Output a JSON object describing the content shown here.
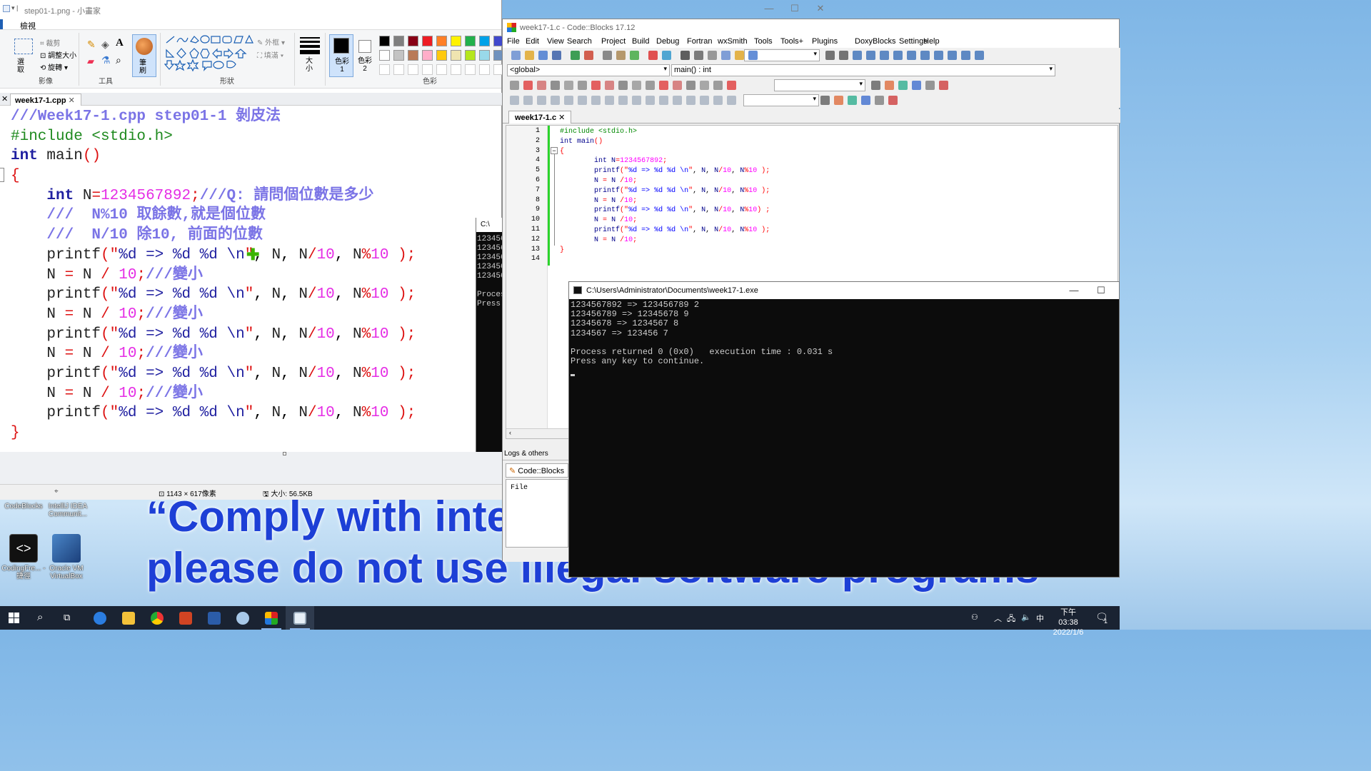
{
  "desktop": {
    "banner_line1": "“Comply with inte",
    "banner_line2": "please do not use illegal software programs",
    "icons": [
      {
        "label": "CodeBlocks"
      },
      {
        "label": "IntelliJ IDEA Communit..."
      },
      {
        "label": "CodingFre... - 捷徑"
      },
      {
        "label": "Oracle VM VirtualBox"
      }
    ]
  },
  "paint": {
    "title": "step01-1.png - 小畫家",
    "tab_view": "檢視",
    "groups": {
      "image": "影像",
      "tools": "工具",
      "shapes": "形狀",
      "colors": "色彩"
    },
    "image_items": {
      "crop": "裁剪",
      "resize": "調整大小",
      "rotate": "旋轉",
      "select": "選取"
    },
    "shape_items": {
      "outline": "外框",
      "fill": "填滿"
    },
    "brush_label": "筆刷",
    "size_label": "大小",
    "color1_label": "色彩 1",
    "color2_label": "色彩 2",
    "doc_tab": "week17-1.cpp",
    "status": {
      "dimensions": "1143 × 617像素",
      "size": "大小: 56.5KB"
    },
    "palette": [
      "#000000",
      "#7f7f7f",
      "#880015",
      "#ed1c24",
      "#ff7f27",
      "#fff200",
      "#22b14c",
      "#00a2e8",
      "#3f48cc",
      "#a349a4",
      "#ffffff",
      "#c3c3c3",
      "#b97a57",
      "#ffaec9",
      "#ffc90e",
      "#efe4b0",
      "#b5e61d",
      "#99d9ea",
      "#7092be",
      "#c8bfe7"
    ],
    "code_lines": [
      "///Week17-1.cpp step01-1 剝皮法",
      "#include <stdio.h>",
      "int main()",
      "{",
      "    int N=1234567892;///Q: 請問個位數是多少",
      "    ///  N%10 取餘數,就是個位數",
      "    ///  N/10 除10, 前面的位數",
      "    printf(\"%d => %d %d \\n\", N, N/10, N%10 );",
      "    N = N / 10;///變小",
      "    printf(\"%d => %d %d \\n\", N, N/10, N%10 );",
      "    N = N / 10;///變小",
      "    printf(\"%d => %d %d \\n\", N, N/10, N%10 );",
      "    N = N / 10;///變小",
      "    printf(\"%d => %d %d \\n\", N, N/10, N%10 );",
      "    N = N / 10;///變小",
      "    printf(\"%d => %d %d \\n\", N, N/10, N%10 );",
      "}"
    ]
  },
  "console_back": {
    "title": "C:\\",
    "lines": [
      "123456",
      "123456",
      "123456",
      "123456",
      "123456",
      "",
      "Proces",
      "Press"
    ]
  },
  "codeblocks": {
    "title": "week17-1.c - Code::Blocks 17.12",
    "menu": [
      "File",
      "Edit",
      "View",
      "Search",
      "Project",
      "Build",
      "Debug",
      "Fortran",
      "wxSmith",
      "Tools",
      "Tools+",
      "Plugins",
      "DoxyBlocks",
      "Settings",
      "Help"
    ],
    "scope_combo": "<global>",
    "func_combo": "main() : int",
    "editor_tab": "week17-1.c",
    "line_numbers": [
      "1",
      "2",
      "3",
      "4",
      "5",
      "6",
      "7",
      "8",
      "9",
      "10",
      "11",
      "12",
      "13",
      "14"
    ],
    "source": [
      "#include <stdio.h>",
      "int main()",
      "{",
      "        int N=1234567892;",
      "        printf(\"%d => %d %d \\n\", N, N/10, N%10 );",
      "        N = N /10;",
      "        printf(\"%d => %d %d \\n\", N, N/10, N%10 );",
      "        N = N /10;",
      "        printf(\"%d => %d %d \\n\", N, N/10, N%10) ;",
      "        N = N /10;",
      "        printf(\"%d => %d %d \\n\", N, N/10, N%10 );",
      "        N = N /10;",
      "}",
      ""
    ],
    "logs_header": "Logs & others",
    "logs_tab": "Code::Blocks",
    "logs_body": "File"
  },
  "console": {
    "title": "C:\\Users\\Administrator\\Documents\\week17-1.exe",
    "lines": [
      "1234567892 => 123456789 2",
      "123456789 => 12345678 9",
      "12345678 => 1234567 8",
      "1234567 => 123456 7",
      "",
      "Process returned 0 (0x0)   execution time : 0.031 s",
      "Press any key to continue."
    ]
  },
  "taskbar": {
    "time": "下午 03:38",
    "date": "2022/1/6",
    "ime": "中",
    "notification_count": "1"
  }
}
